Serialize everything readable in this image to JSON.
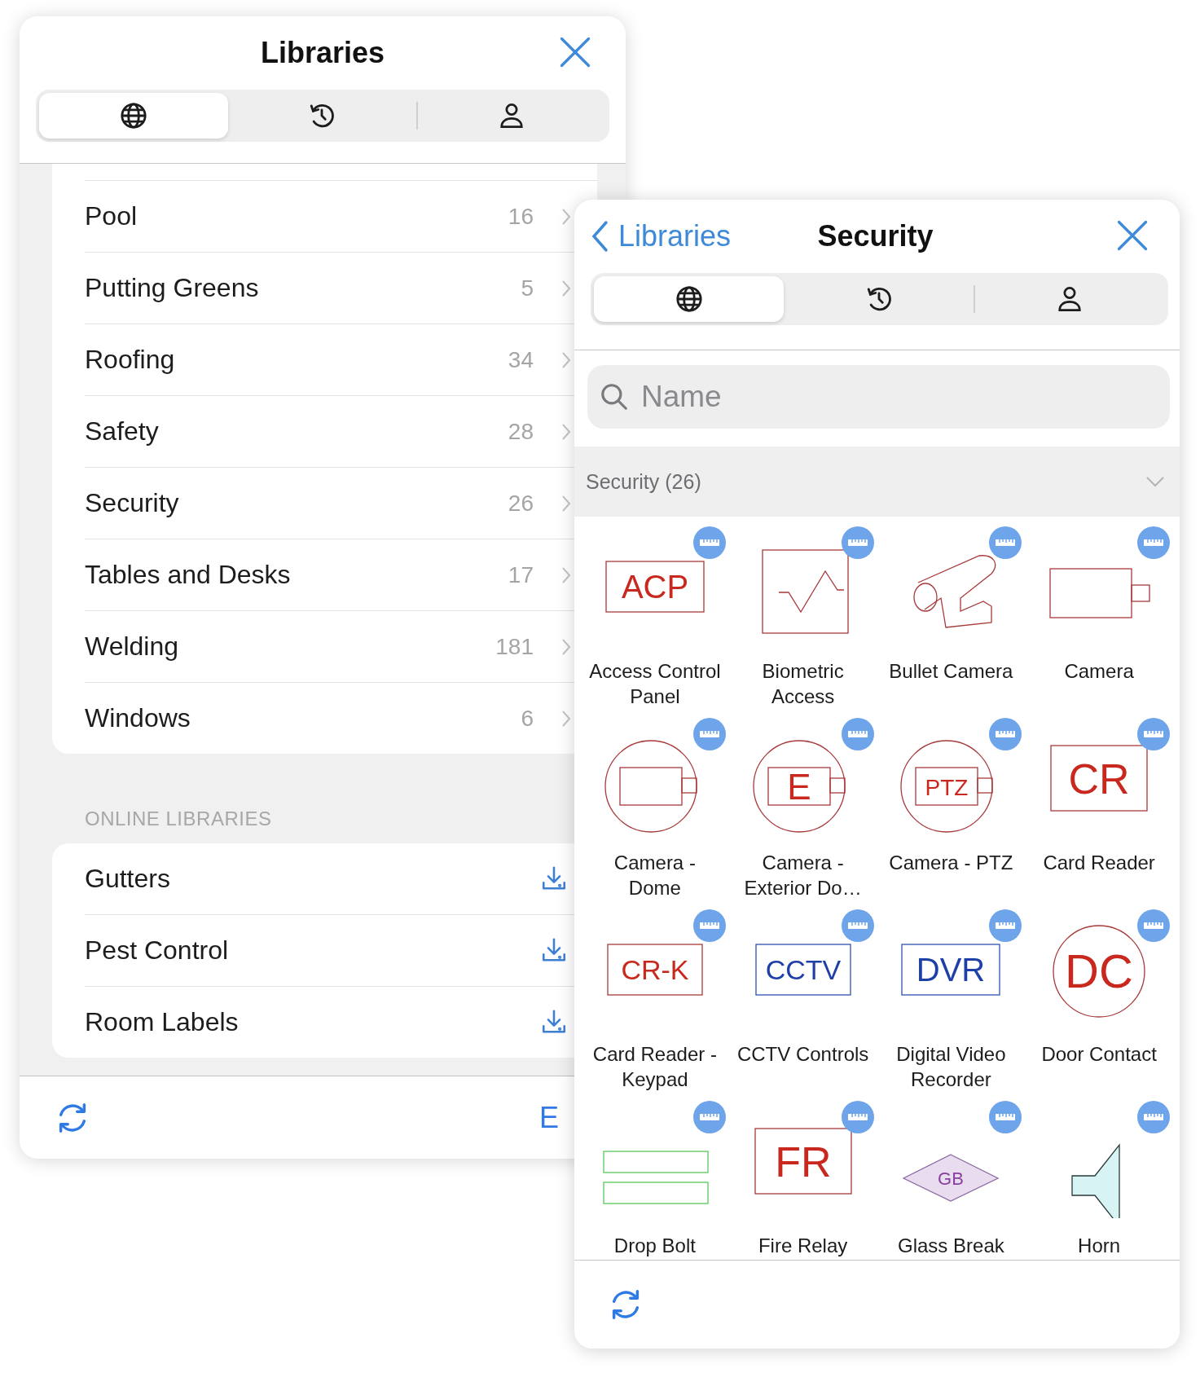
{
  "left_panel": {
    "title": "Libraries",
    "tabs": [
      {
        "selected": true
      },
      {
        "selected": false
      },
      {
        "selected": false
      }
    ],
    "libraries": [
      {
        "name": "Pool",
        "count": "16"
      },
      {
        "name": "Putting Greens",
        "count": "5"
      },
      {
        "name": "Roofing",
        "count": "34"
      },
      {
        "name": "Safety",
        "count": "28"
      },
      {
        "name": "Security",
        "count": "26"
      },
      {
        "name": "Tables and Desks",
        "count": "17"
      },
      {
        "name": "Welding",
        "count": "181"
      },
      {
        "name": "Windows",
        "count": "6"
      }
    ],
    "section_header": "ONLINE LIBRARIES",
    "online_libraries": [
      {
        "name": "Gutters"
      },
      {
        "name": "Pest Control"
      },
      {
        "name": "Room Labels"
      }
    ],
    "edit_button": "E"
  },
  "right_panel": {
    "back_label": "Libraries",
    "title": "Security",
    "tabs": [
      {
        "selected": true
      },
      {
        "selected": false
      },
      {
        "selected": false
      }
    ],
    "search": {
      "placeholder": "Name"
    },
    "group": {
      "title": "Security (26)",
      "expanded": true
    },
    "symbols": [
      {
        "name": "Access Control Panel",
        "kind": "label-box",
        "symbol_text": "ACP",
        "color": "#c8281e"
      },
      {
        "name": "Biometric Access",
        "kind": "biometric"
      },
      {
        "name": "Bullet Camera",
        "kind": "bullet-camera"
      },
      {
        "name": "Camera",
        "kind": "camera"
      },
      {
        "name": "Camera - Dome",
        "kind": "dome"
      },
      {
        "name": "Camera - Exterior Do…",
        "kind": "dome",
        "symbol_text": "E",
        "color": "#c8281e"
      },
      {
        "name": "Camera - PTZ",
        "kind": "dome",
        "symbol_text": "PTZ",
        "color": "#c8281e"
      },
      {
        "name": "Card Reader",
        "kind": "label-box",
        "symbol_text": "CR",
        "color": "#c8281e"
      },
      {
        "name": "Card Reader - Keypad",
        "kind": "label-box",
        "symbol_text": "CR-K",
        "color": "#c8281e"
      },
      {
        "name": "CCTV Controls",
        "kind": "label-box",
        "symbol_text": "CCTV",
        "color": "#1f3fa8"
      },
      {
        "name": "Digital Video Recorder",
        "kind": "label-box",
        "symbol_text": "DVR",
        "color": "#1f3fa8"
      },
      {
        "name": "Door Contact",
        "kind": "circle",
        "symbol_text": "DC",
        "color": "#c8281e"
      },
      {
        "name": "Drop Bolt",
        "kind": "drop-bolt"
      },
      {
        "name": "Fire Relay",
        "kind": "label-box",
        "symbol_text": "FR",
        "color": "#c8281e"
      },
      {
        "name": "Glass Break",
        "kind": "diamond",
        "symbol_text": "GB",
        "color": "#8a3fa0"
      },
      {
        "name": "Horn",
        "kind": "horn"
      }
    ]
  }
}
